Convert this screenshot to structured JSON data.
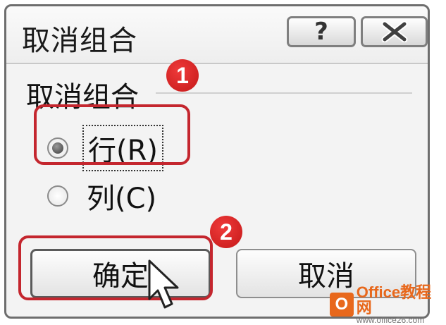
{
  "dialog": {
    "title": "取消组合",
    "help_label": "?",
    "close_label": "✕"
  },
  "group": {
    "label": "取消组合",
    "options": [
      {
        "label": "行(R)",
        "selected": true
      },
      {
        "label": "列(C)",
        "selected": false
      }
    ]
  },
  "buttons": {
    "ok": "确定",
    "cancel": "取消"
  },
  "annotations": {
    "badge1": "1",
    "badge2": "2",
    "highlight_color": "#c4262e"
  },
  "watermark": {
    "logo": "O",
    "name": "Office教程网",
    "url": "www.office26.com"
  }
}
